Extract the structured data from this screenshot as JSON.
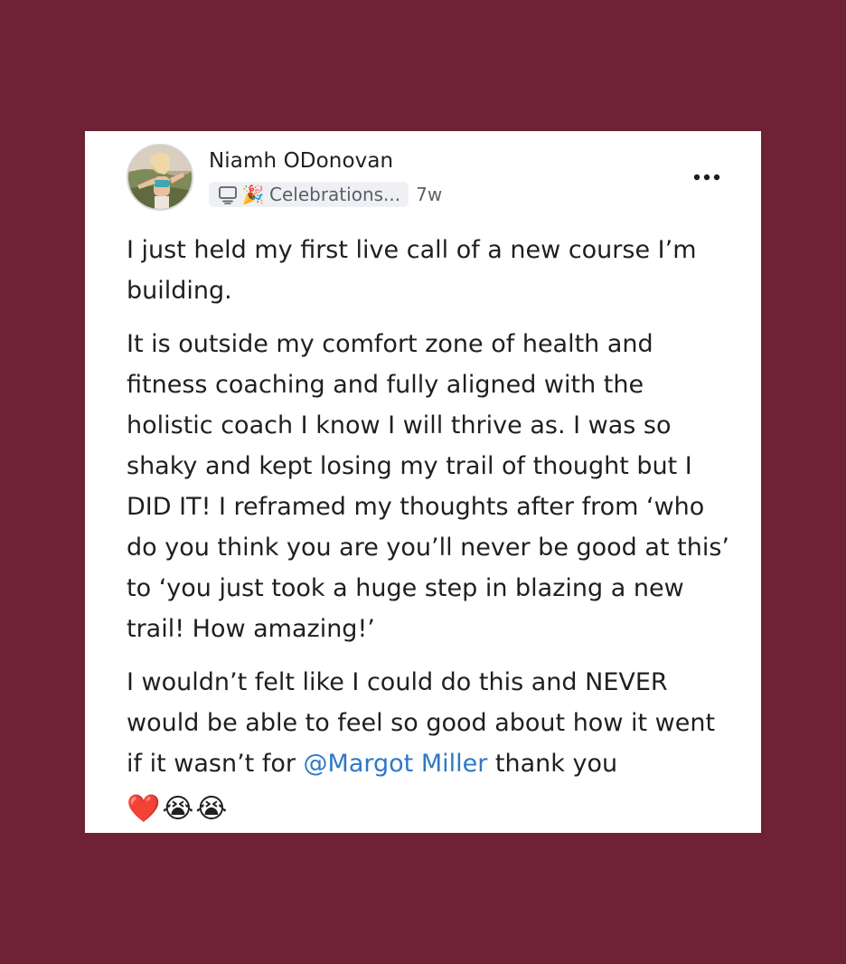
{
  "post": {
    "author": "Niamh ODonovan",
    "group_emoji": "🎉",
    "group_label": "Celebrations...",
    "time": "7w",
    "paragraphs": [
      "I just held my first live call of a new course I’m building.",
      "It is outside my comfort zone of health and fitness coaching and fully aligned with the holistic coach I know I will thrive as. I was so shaky and kept losing my trail of thought but I DID IT! I reframed my thoughts after from ‘who do you think you are you’ll never be good at this’ to ‘you just took a huge step in blazing a new trail! How amazing!’"
    ],
    "closing": {
      "before_mention": "I wouldn’t felt like I could do this and NEVER would be able to feel so good about how it went if it wasn’t for ",
      "mention": "@Margot Miller",
      "after_mention": " thank you"
    },
    "emojis": [
      "❤️",
      "😭",
      "😭"
    ]
  },
  "icons": {
    "group_type": "computer-icon",
    "more": "more-dots-icon"
  },
  "colors": {
    "background": "#6e2234",
    "card": "#ffffff",
    "mention": "#2f78c4",
    "meta_text": "#5a5f67",
    "pill_bg": "#eef0f3"
  }
}
